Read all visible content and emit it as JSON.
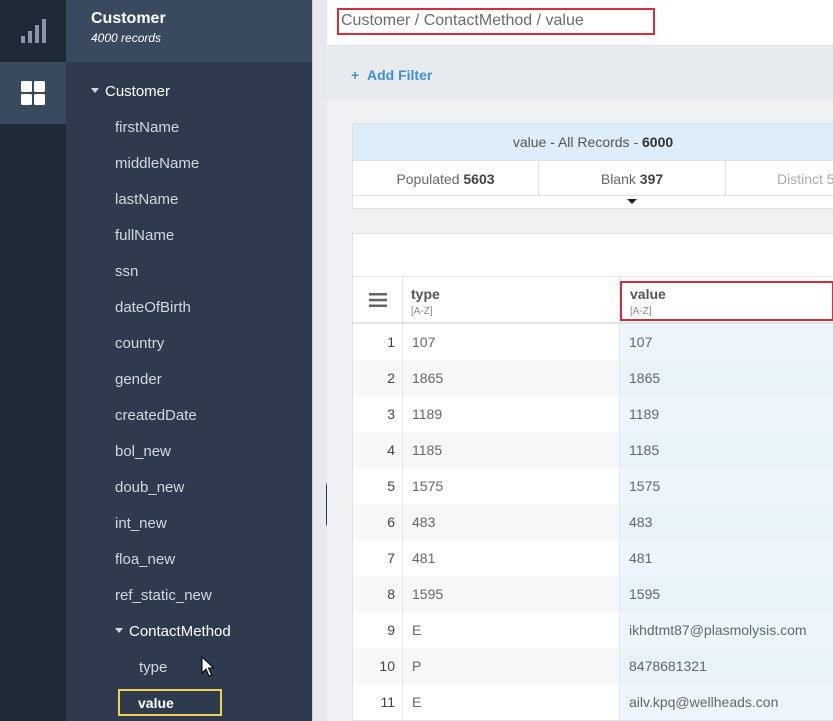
{
  "sidebar": {
    "title": "Customer",
    "subtitle": "4000 records",
    "tree": {
      "root": "Customer",
      "fields": [
        "firstName",
        "middleName",
        "lastName",
        "fullName",
        "ssn",
        "dateOfBirth",
        "country",
        "gender",
        "createdDate",
        "bol_new",
        "doub_new",
        "int_new",
        "floa_new",
        "ref_static_new"
      ],
      "child_group": "ContactMethod",
      "child_fields": [
        "type"
      ],
      "selected_field": "value"
    }
  },
  "breadcrumb": "Customer / ContactMethod / value",
  "toolbar": {
    "add_filter_label": "Add Filter"
  },
  "stats": {
    "field": "value",
    "dash1": " - ",
    "all_records_label": "All Records",
    "dash2": " - ",
    "total": "6000",
    "populated_label": "Populated",
    "populated": "5603",
    "blank_label": "Blank",
    "blank": "397",
    "distinct_label": "Distinct",
    "distinct": "5"
  },
  "grid": {
    "columns": [
      {
        "name": "type",
        "sort": "[A-Z]"
      },
      {
        "name": "value",
        "sort": "[A-Z]"
      }
    ],
    "rows": [
      {
        "n": "1",
        "type": "107",
        "value": "107"
      },
      {
        "n": "2",
        "type": "1865",
        "value": "1865"
      },
      {
        "n": "3",
        "type": "1189",
        "value": "1189"
      },
      {
        "n": "4",
        "type": "1185",
        "value": "1185"
      },
      {
        "n": "5",
        "type": "1575",
        "value": "1575"
      },
      {
        "n": "6",
        "type": "483",
        "value": "483"
      },
      {
        "n": "7",
        "type": "481",
        "value": "481"
      },
      {
        "n": "8",
        "type": "1595",
        "value": "1595"
      },
      {
        "n": "9",
        "type": "E",
        "value": "ikhdtmt87@plasmolysis.com"
      },
      {
        "n": "10",
        "type": "P",
        "value": "8478681321"
      },
      {
        "n": "11",
        "type": "E",
        "value": "ailv.kpq@wellheads.con"
      }
    ]
  },
  "colors": {
    "rail_bg": "#1f2a38",
    "sidebar_bg": "#2e3b4e",
    "accent_blue": "#3f8fd2",
    "highlight_red": "#d0303a",
    "selected_yellow": "#f0d050"
  },
  "icons": [
    "bar-chart-icon",
    "grid-icon",
    "menu-icon",
    "chevron-down-icon"
  ]
}
